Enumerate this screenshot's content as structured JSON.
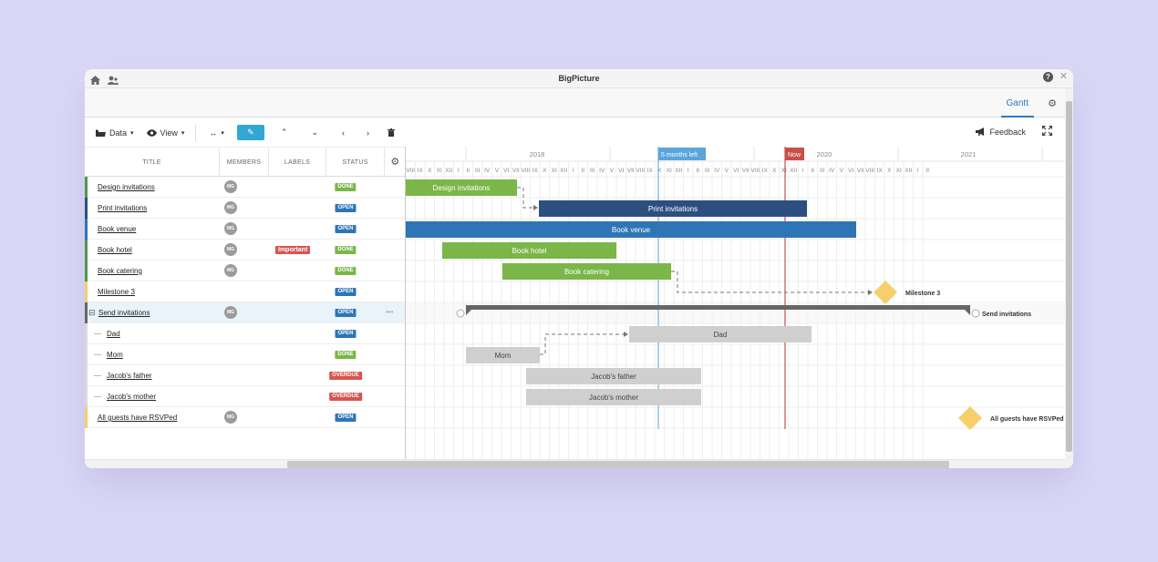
{
  "window": {
    "title": "BigPicture"
  },
  "topbar": {
    "tab_gantt": "Gantt"
  },
  "toolbar": {
    "data": "Data",
    "view": "View",
    "feedback": "Feedback"
  },
  "columns": {
    "title": "TITLE",
    "members": "MEMBERS",
    "labels": "LABELS",
    "status": "STATUS"
  },
  "timeline": {
    "years": [
      "2018",
      "2020",
      "2021"
    ],
    "markers": {
      "today": "5 months left",
      "now": "Now"
    },
    "months": [
      "VIII",
      "IX",
      "X",
      "XI",
      "XII",
      "I",
      "II",
      "III",
      "IV",
      "V",
      "VI",
      "VII",
      "VIII",
      "IX",
      "X",
      "XI",
      "XII",
      "I",
      "II",
      "III",
      "IV",
      "V",
      "VI",
      "VII",
      "VIII",
      "IX",
      "X",
      "XI",
      "XII",
      "I",
      "II",
      "III",
      "IV",
      "V",
      "VI",
      "VII",
      "VIII",
      "IX",
      "X",
      "XI",
      "XII",
      "I",
      "II",
      "III",
      "IV",
      "V",
      "VI",
      "VII",
      "VIII",
      "IX",
      "X",
      "XI",
      "XII",
      "I",
      "II"
    ]
  },
  "rows": [
    {
      "title": "Design invitations",
      "member": "MG",
      "label": "",
      "status": "DONE",
      "color": "#4b9b4b",
      "indent": 0
    },
    {
      "title": "Print invitations",
      "member": "MG",
      "label": "",
      "status": "OPEN",
      "color": "#2c4f80",
      "indent": 0
    },
    {
      "title": "Book venue",
      "member": "MG",
      "label": "",
      "status": "OPEN",
      "color": "#2e75b6",
      "indent": 0
    },
    {
      "title": "Book hotel",
      "member": "MG",
      "label": "Important",
      "status": "DONE",
      "color": "#4b9b4b",
      "indent": 0
    },
    {
      "title": "Book catering",
      "member": "MG",
      "label": "",
      "status": "DONE",
      "color": "#4b9b4b",
      "indent": 0
    },
    {
      "title": "Milestone 3",
      "member": "",
      "label": "",
      "status": "OPEN",
      "color": "#f6cf6a",
      "indent": 0
    },
    {
      "title": "Send invitations",
      "member": "MG",
      "label": "",
      "status": "OPEN",
      "color": "#666666",
      "indent": 0,
      "group": true
    },
    {
      "title": "Dad",
      "member": "",
      "label": "",
      "status": "OPEN",
      "color": "#cccccc",
      "indent": 1
    },
    {
      "title": "Mom",
      "member": "",
      "label": "",
      "status": "DONE",
      "color": "#cccccc",
      "indent": 1
    },
    {
      "title": "Jacob's father",
      "member": "",
      "label": "",
      "status": "OVERDUE",
      "color": "#cccccc",
      "indent": 1
    },
    {
      "title": "Jacob's mother",
      "member": "",
      "label": "",
      "status": "OVERDUE",
      "color": "#cccccc",
      "indent": 1
    },
    {
      "title": "All guests have RSVPed",
      "member": "MG",
      "label": "",
      "status": "OPEN",
      "color": "#f6cf6a",
      "indent": 0
    }
  ],
  "bars": [
    {
      "label": "Design invitations",
      "color": "#7ab648",
      "text_color": "#ffffff"
    },
    {
      "label": "Print invitations",
      "color": "#2c4f80",
      "text_color": "#ffffff"
    },
    {
      "label": "Book venue",
      "color": "#2e75b6",
      "text_color": "#ffffff"
    },
    {
      "label": "Book hotel",
      "color": "#7ab648",
      "text_color": "#ffffff"
    },
    {
      "label": "Book catering",
      "color": "#7ab648",
      "text_color": "#ffffff"
    },
    {
      "label": "Milestone 3",
      "color": "#f6cf6a",
      "text_color": "#333333"
    },
    {
      "label": "Send invitations",
      "color": "#666666",
      "text_color": "#333333"
    },
    {
      "label": "Dad",
      "color": "#cfcfcf",
      "text_color": "#444444"
    },
    {
      "label": "Mom",
      "color": "#cfcfcf",
      "text_color": "#444444"
    },
    {
      "label": "Jacob's father",
      "color": "#cfcfcf",
      "text_color": "#444444"
    },
    {
      "label": "Jacob's mother",
      "color": "#cfcfcf",
      "text_color": "#444444"
    },
    {
      "label": "All guests have RSVPed",
      "color": "#f6cf6a",
      "text_color": "#333333"
    }
  ],
  "status_colors": {
    "DONE": "#7ab648",
    "OPEN": "#2e75b6",
    "OVERDUE": "#d9534f"
  },
  "icons": [
    "home-icon",
    "users-icon",
    "help-icon",
    "close-icon",
    "gear-icon",
    "folder-icon",
    "eye-icon",
    "arrows-horizontal-icon",
    "pencil-icon",
    "chevron-up-icon",
    "chevron-down-icon",
    "chevron-left-icon",
    "chevron-right-icon",
    "trash-icon",
    "megaphone-icon",
    "expand-icon"
  ]
}
